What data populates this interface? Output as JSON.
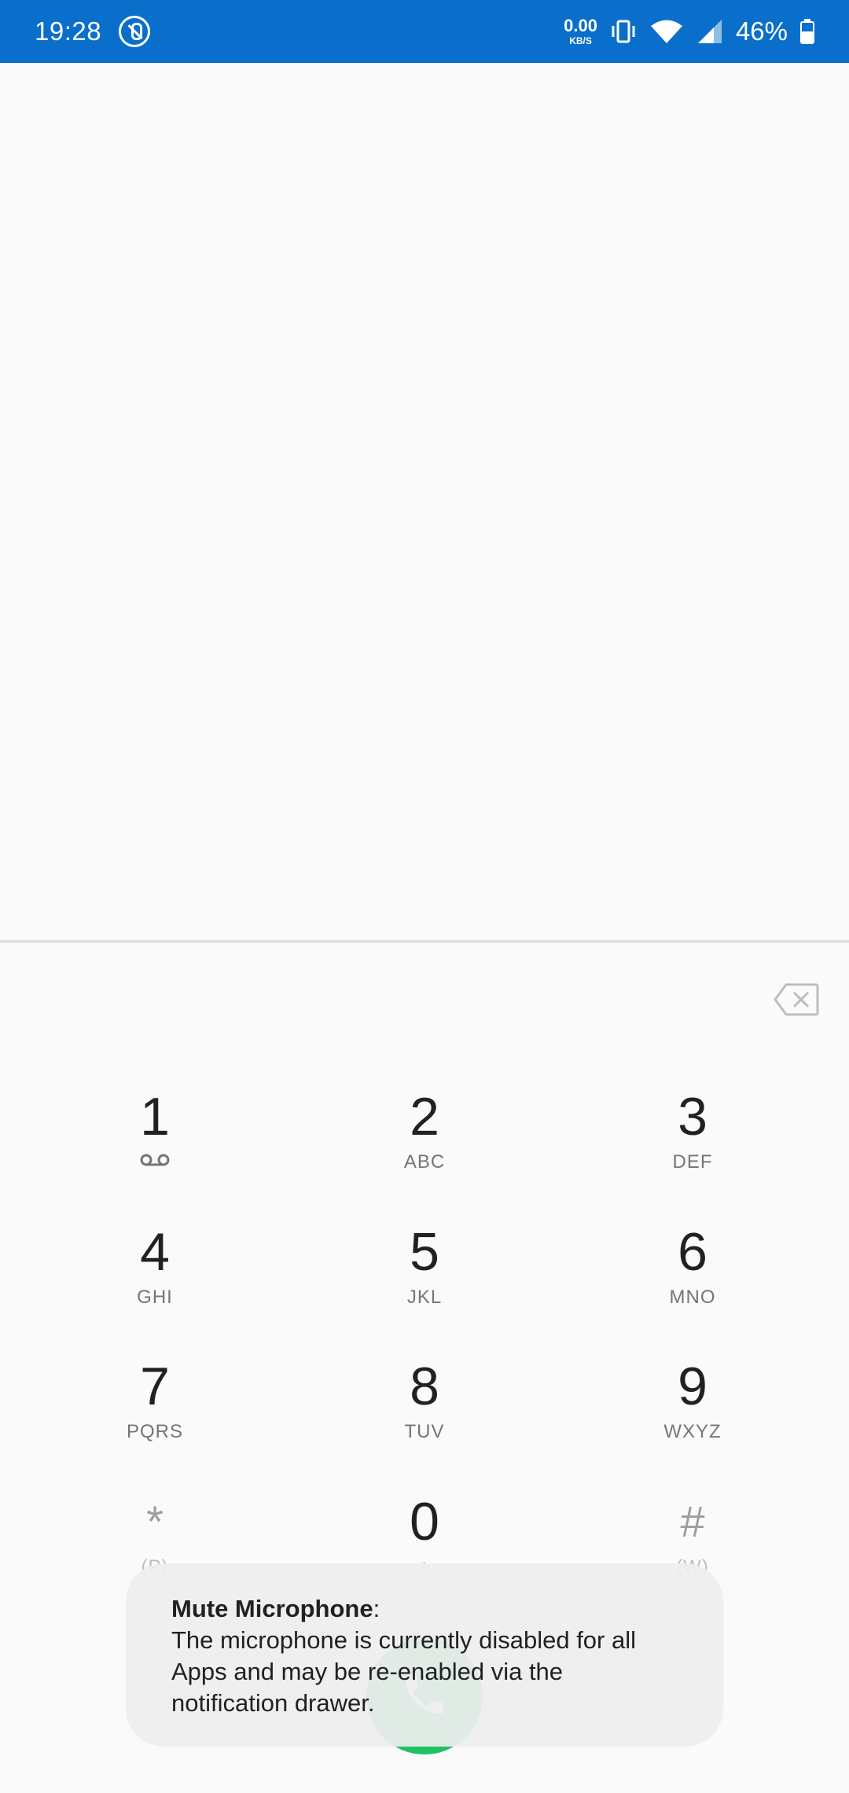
{
  "status_bar": {
    "time": "19:28",
    "net_speed_value": "0.00",
    "net_speed_unit": "KB/S",
    "battery_percent": "46%",
    "background_color": "#0a6fcb"
  },
  "keypad": {
    "keys": [
      {
        "digit": "1",
        "letters": ""
      },
      {
        "digit": "2",
        "letters": "ABC"
      },
      {
        "digit": "3",
        "letters": "DEF"
      },
      {
        "digit": "4",
        "letters": "GHI"
      },
      {
        "digit": "5",
        "letters": "JKL"
      },
      {
        "digit": "6",
        "letters": "MNO"
      },
      {
        "digit": "7",
        "letters": "PQRS"
      },
      {
        "digit": "8",
        "letters": "TUV"
      },
      {
        "digit": "9",
        "letters": "WXYZ"
      },
      {
        "digit": "*",
        "letters": "(P)"
      },
      {
        "digit": "0",
        "letters": "+"
      },
      {
        "digit": "#",
        "letters": "(W)"
      }
    ]
  },
  "toast": {
    "title": "Mute Microphone",
    "title_suffix": ":",
    "message": "The microphone is currently disabled for all Apps and may be re-enabled via the notification drawer."
  },
  "icons": {
    "backspace": "backspace-icon",
    "call": "phone-icon",
    "voicemail": "voicemail-icon",
    "mic_off": "mic-off-icon",
    "vibrate": "vibrate-icon",
    "wifi": "wifi-icon",
    "signal": "signal-icon",
    "battery": "battery-icon"
  },
  "colors": {
    "call_button": "#21c063",
    "accent": "#0a6fcb"
  }
}
